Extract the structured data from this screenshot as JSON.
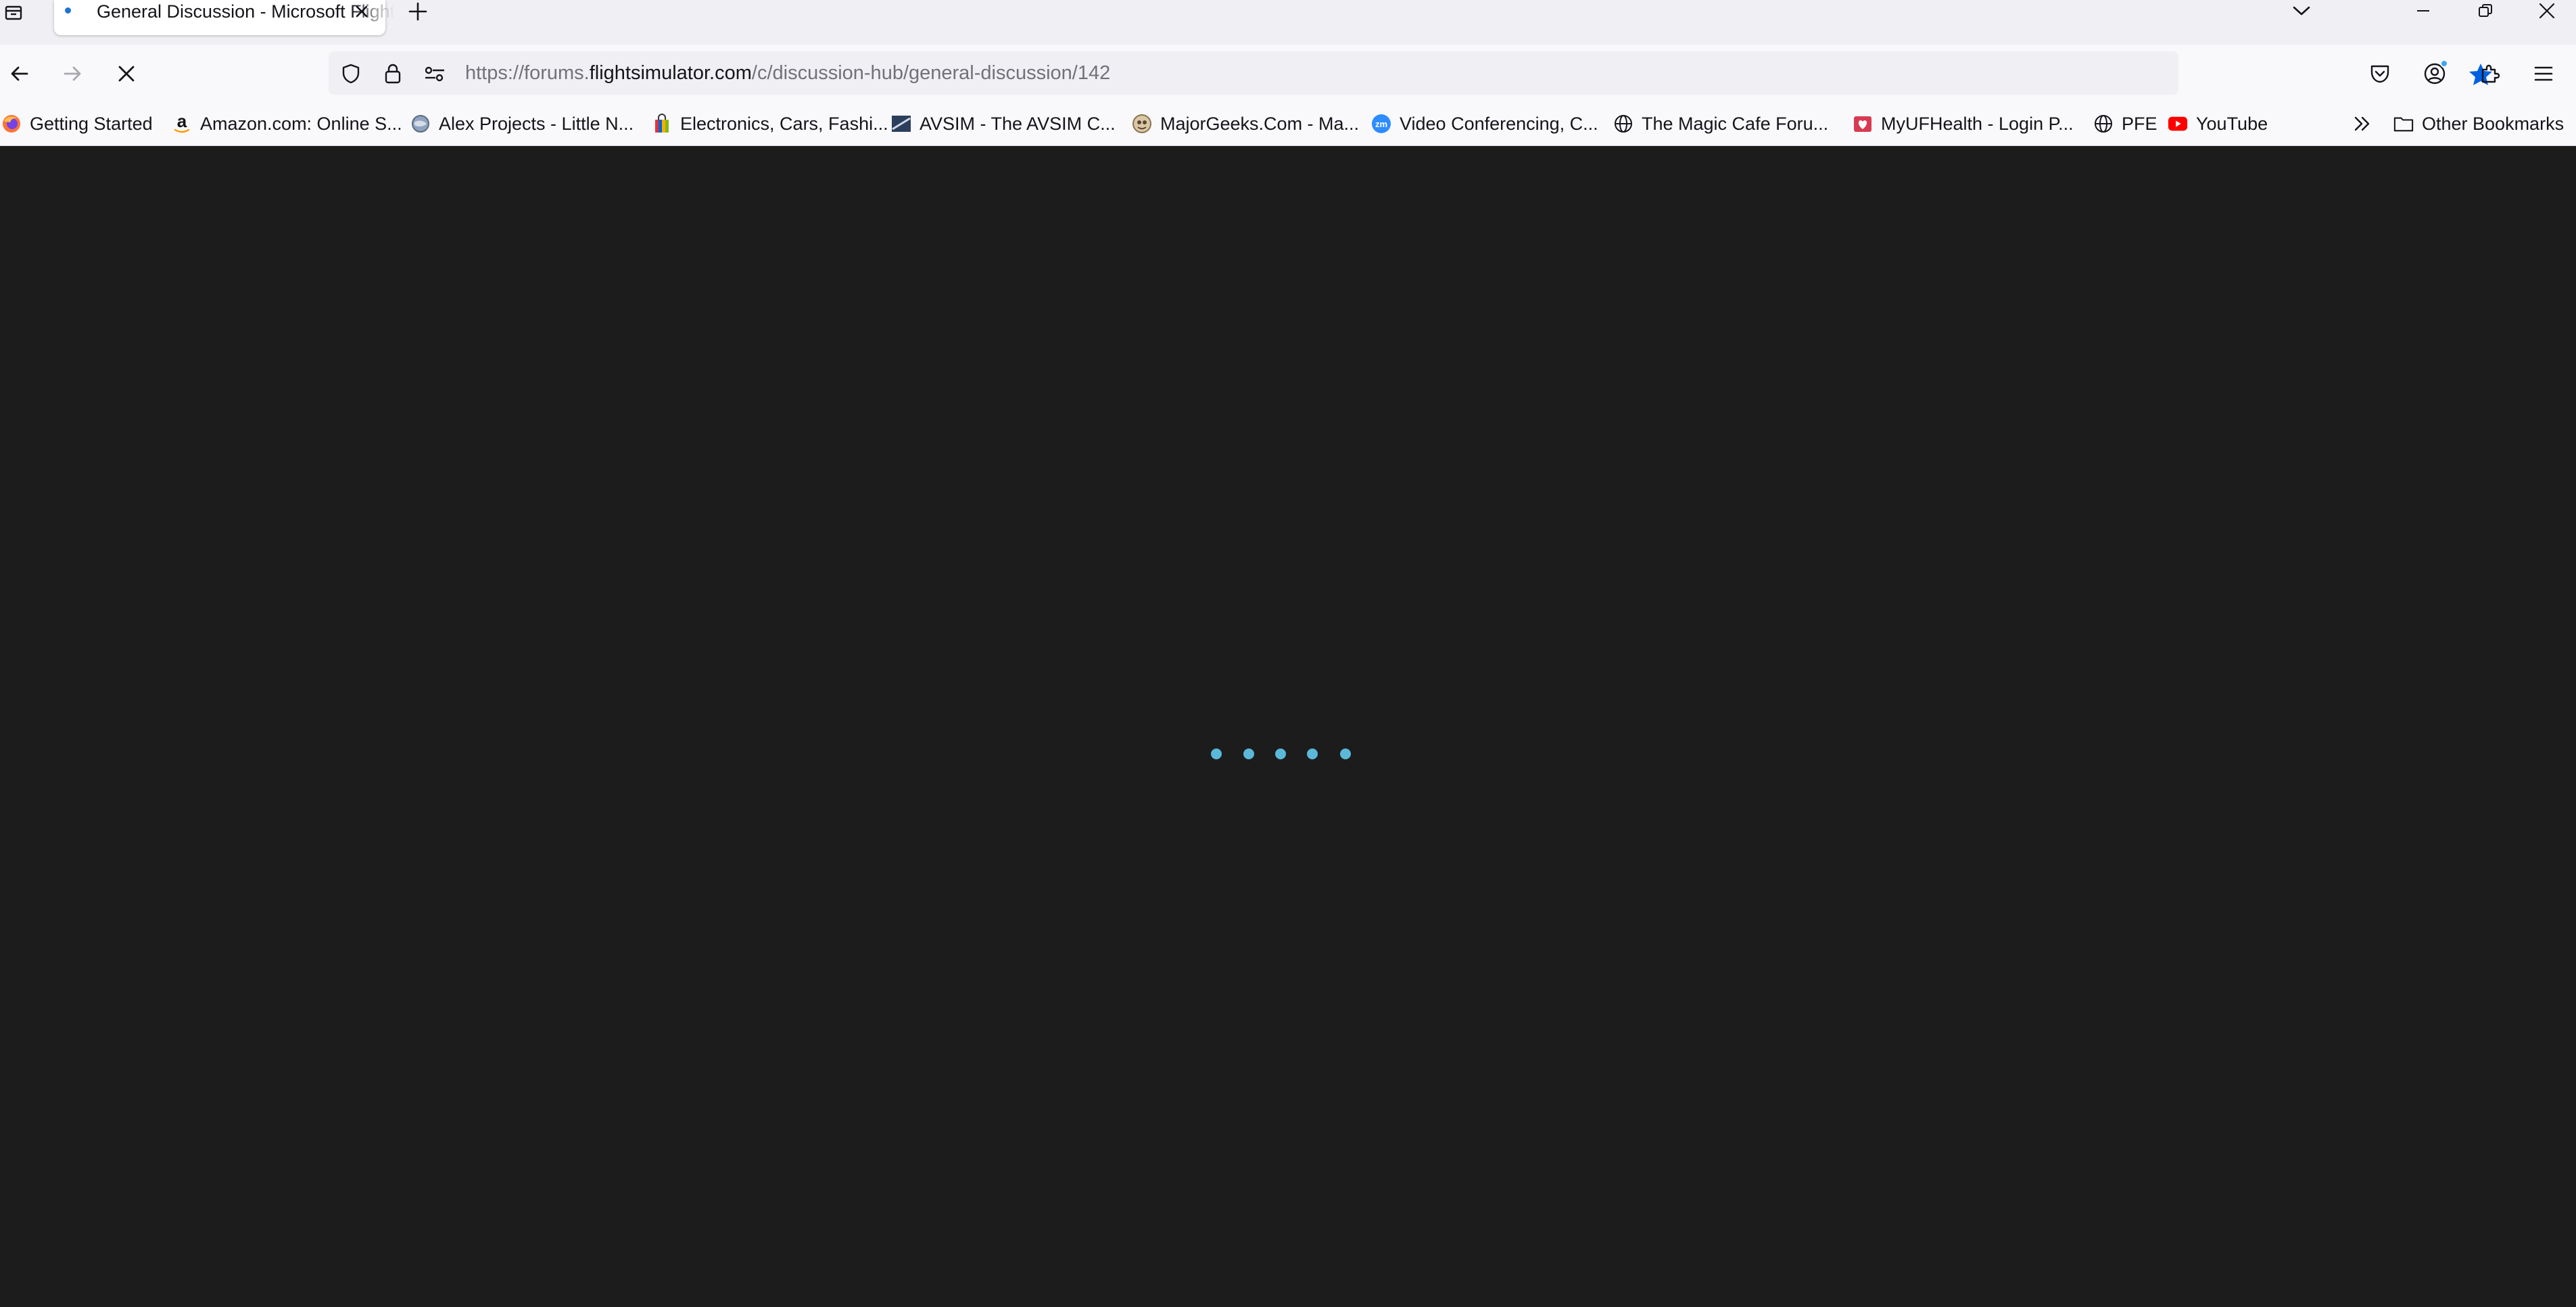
{
  "tab": {
    "title": "General Discussion - Microsoft Flight Simulator Forums",
    "loading": true
  },
  "nav": {
    "url_prefix": "https://forums.",
    "url_host": "flightsimulator.com",
    "url_path": "/c/discussion-hub/general-discussion/142",
    "bookmarked": true
  },
  "bookmarks": {
    "items": [
      {
        "label": "Getting Started",
        "icon": "firefox-icon"
      },
      {
        "label": "Amazon.com: Online S...",
        "icon": "amazon-icon"
      },
      {
        "label": "Alex Projects - Little N...",
        "icon": "globe-photo-icon"
      },
      {
        "label": "Electronics, Cars, Fashi...",
        "icon": "ebay-bag-icon"
      },
      {
        "label": "AVSIM - The AVSIM C...",
        "icon": "avsim-icon"
      },
      {
        "label": "MajorGeeks.Com - Ma...",
        "icon": "majorgeeks-icon"
      },
      {
        "label": "Video Conferencing, C...",
        "icon": "zoom-icon"
      },
      {
        "label": "The Magic Cafe Foru...",
        "icon": "globe-icon"
      },
      {
        "label": "MyUFHealth - Login P...",
        "icon": "ufhealth-icon"
      },
      {
        "label": "PFE",
        "icon": "globe-icon"
      },
      {
        "label": "YouTube",
        "icon": "youtube-icon"
      }
    ],
    "other_label": "Other Bookmarks"
  },
  "colors": {
    "page_background": "#1c1c1c",
    "loader_dot": "#5bb8d8",
    "accent": "#0061e0"
  }
}
